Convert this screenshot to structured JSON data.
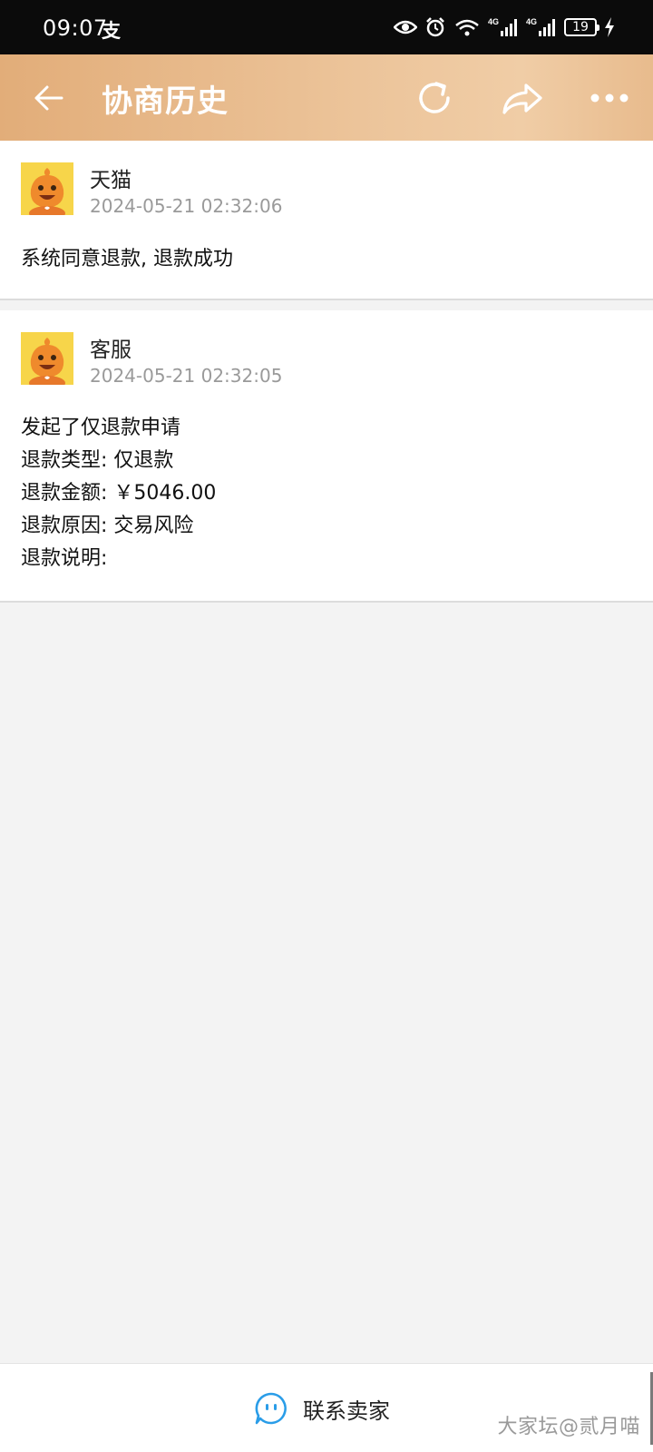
{
  "status_bar": {
    "time": "09:07",
    "app_indicator": "支",
    "battery_level": "19",
    "icons": [
      "eye-icon",
      "alarm-icon",
      "wifi-icon",
      "signal-4g-icon",
      "signal-4g-icon",
      "battery-icon",
      "charging-icon"
    ]
  },
  "header": {
    "title": "协商历史",
    "back_icon": "back-arrow-icon",
    "refresh_icon": "refresh-icon",
    "share_icon": "share-icon",
    "more_icon": "more-dots-icon",
    "gradient_colors": [
      "#e2ad79",
      "#f0cda6"
    ]
  },
  "messages": [
    {
      "sender": "天猫",
      "time": "2024-05-21 02:32:06",
      "lines": [
        "系统同意退款, 退款成功"
      ]
    },
    {
      "sender": "客服",
      "time": "2024-05-21 02:32:05",
      "lines": [
        "发起了仅退款申请",
        "退款类型: 仅退款",
        "退款金额: ￥5046.00",
        "退款原因: 交易风险",
        "退款说明:"
      ]
    }
  ],
  "footer": {
    "contact_label": "联系卖家",
    "contact_icon": "chat-bubble-icon",
    "accent": "#2a9de8"
  },
  "watermark": "大家坛@贰月喵"
}
